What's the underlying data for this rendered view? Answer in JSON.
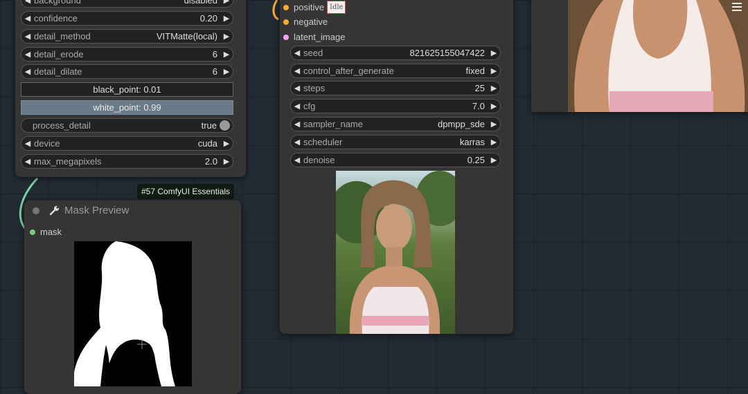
{
  "remove_bg_node": {
    "widgets": [
      {
        "label": "background",
        "value": "disabled"
      },
      {
        "label": "confidence",
        "value": "0.20"
      },
      {
        "label": "detail_method",
        "value": "VITMatte(local)"
      },
      {
        "label": "detail_erode",
        "value": "6"
      },
      {
        "label": "detail_dilate",
        "value": "6"
      }
    ],
    "black_point": "black_point: 0.01",
    "white_point": "white_point: 0.99",
    "process_detail": {
      "label": "process_detail",
      "value": "true"
    },
    "device": {
      "label": "device",
      "value": "cuda"
    },
    "max_megapixels": {
      "label": "max_megapixels",
      "value": "2.0"
    }
  },
  "mask_preview_node": {
    "badge": "#57 ComfyUI Essentials",
    "title": "Mask Preview",
    "input": "mask"
  },
  "ksampler_node": {
    "status": "Idle",
    "inputs": [
      "positive",
      "negative",
      "latent_image"
    ],
    "widgets": [
      {
        "label": "seed",
        "value": "821625155047422"
      },
      {
        "label": "control_after_generate",
        "value": "fixed"
      },
      {
        "label": "steps",
        "value": "25"
      },
      {
        "label": "cfg",
        "value": "7.0"
      },
      {
        "label": "sampler_name",
        "value": "dpmpp_sde"
      },
      {
        "label": "scheduler",
        "value": "karras"
      },
      {
        "label": "denoise",
        "value": "0.25"
      }
    ]
  },
  "colors": {
    "canvas": "#222b33",
    "node": "#353535",
    "slot_conditioning": "#ffa931",
    "slot_latent": "#ff9cf9",
    "slot_mask": "#81c784",
    "link": "#7dd3a8"
  },
  "icons": [
    "left-arrow-icon",
    "right-arrow-icon",
    "wrench-icon",
    "menu-icon",
    "plus-cursor-icon"
  ]
}
